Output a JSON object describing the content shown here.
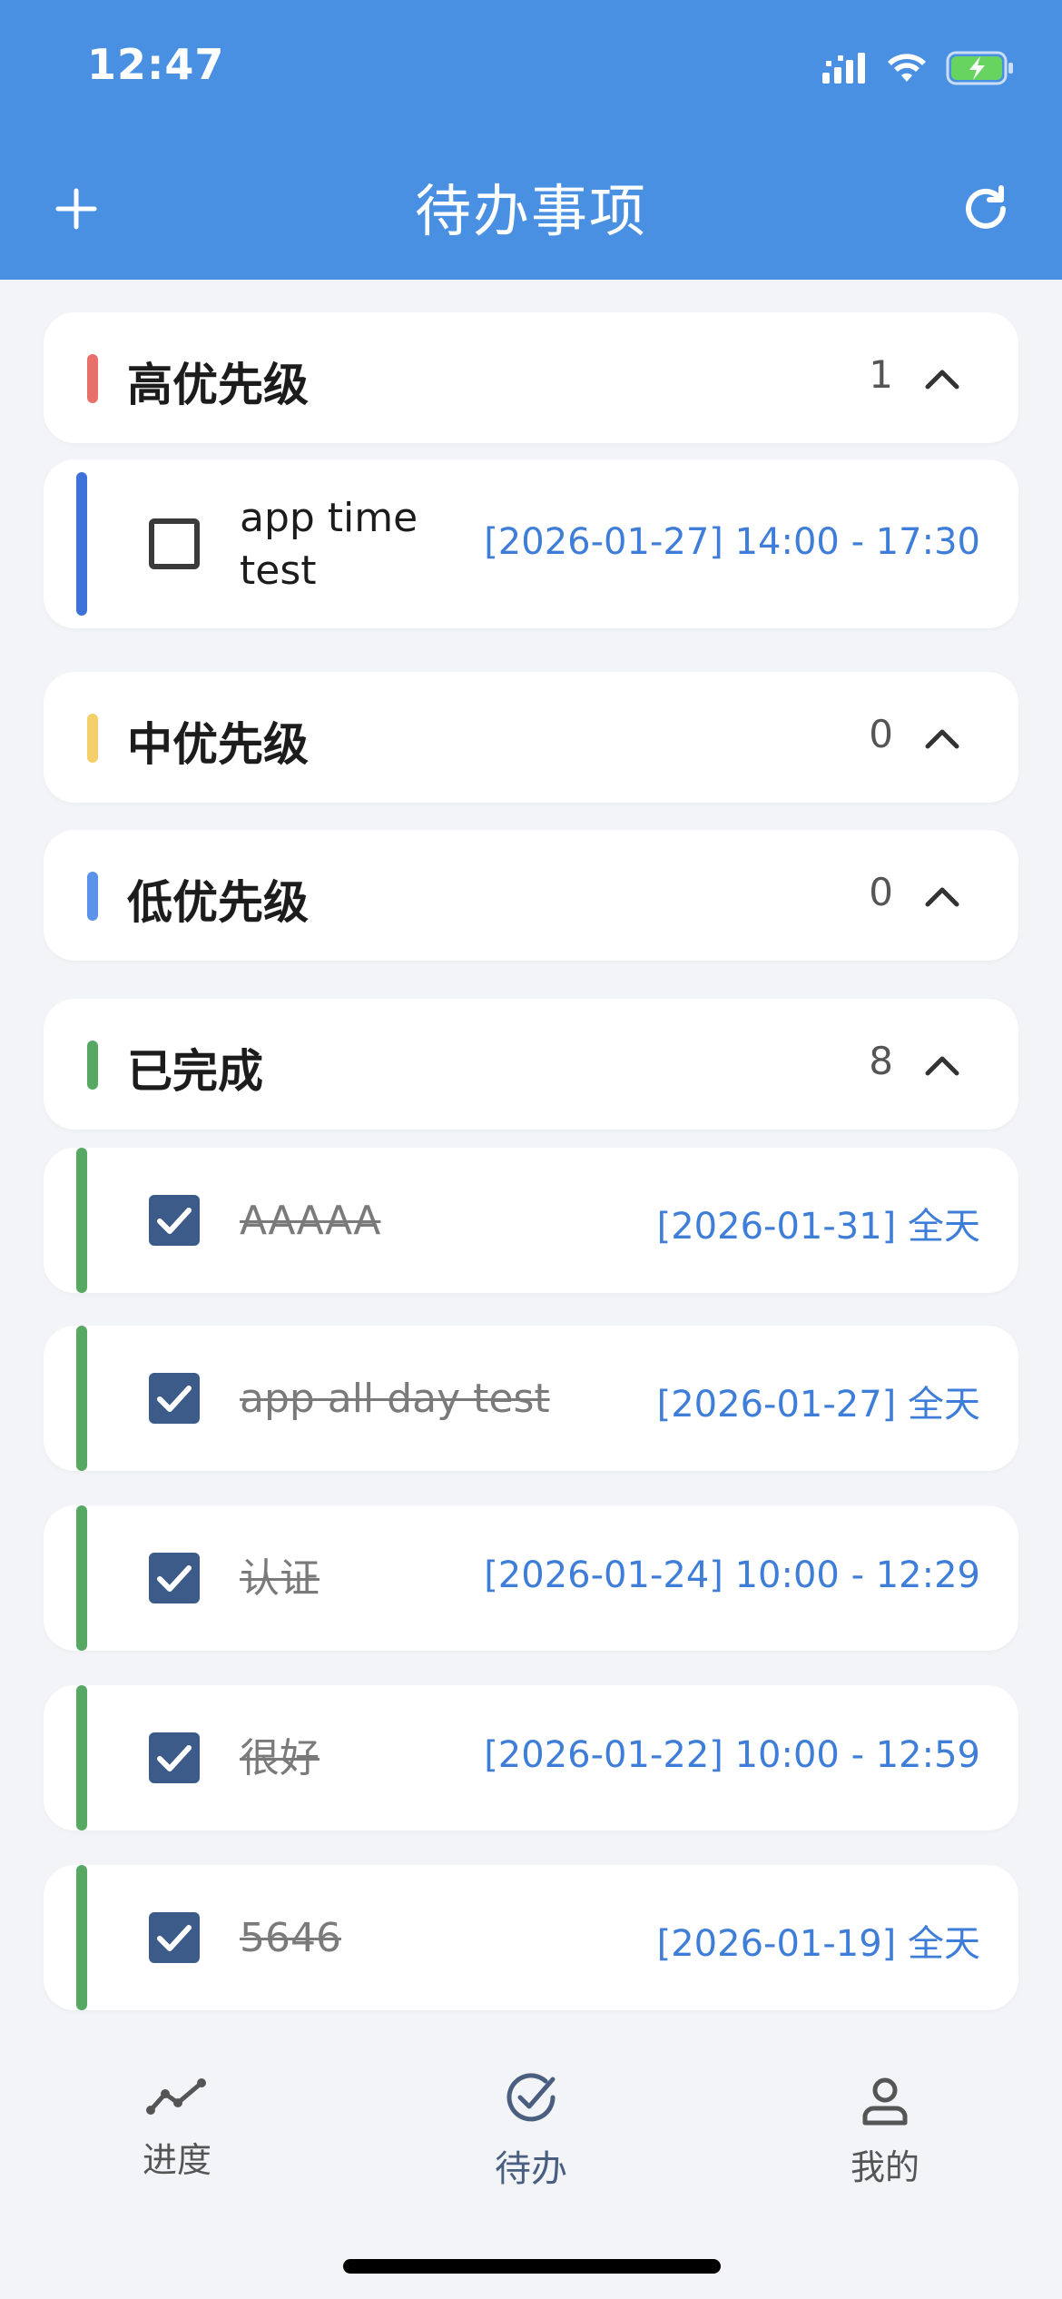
{
  "status_bar": {
    "time": "12:47"
  },
  "header": {
    "title": "待办事项",
    "add_icon": "plus-icon",
    "refresh_icon": "refresh-icon"
  },
  "colors": {
    "header_bg": "#4a90e2",
    "high": "#e8706a",
    "medium": "#f4cf6a",
    "low": "#5b93ea",
    "done": "#56a863",
    "task_bar_high": "#3f72d8",
    "date": "#3f7ed8",
    "checkbox_checked": "#3c5b88"
  },
  "sections": [
    {
      "title": "高优先级",
      "count": "1"
    },
    {
      "title": "中优先级",
      "count": "0"
    },
    {
      "title": "低优先级",
      "count": "0"
    },
    {
      "title": "已完成",
      "count": "8"
    }
  ],
  "high_tasks": [
    {
      "name_line1": "app time",
      "name_line2": "test",
      "date": "[2026-01-27] 14:00 - 17:30",
      "checked": false
    }
  ],
  "done_tasks": [
    {
      "name": "AAAAA",
      "date": "[2026-01-31] 全天",
      "checked": true
    },
    {
      "name": "app all day test",
      "date": "[2026-01-27] 全天",
      "checked": true
    },
    {
      "name": "认证",
      "date": "[2026-01-24] 10:00 - 12:29",
      "checked": true
    },
    {
      "name": "很好",
      "date": "[2026-01-22] 10:00 - 12:59",
      "checked": true
    },
    {
      "name": "5646",
      "date": "[2026-01-19] 全天",
      "checked": true
    }
  ],
  "bottom_nav": [
    {
      "label": "进度",
      "icon": "progress-chart-icon"
    },
    {
      "label": "待办",
      "icon": "check-circle-icon",
      "active": true
    },
    {
      "label": "我的",
      "icon": "profile-icon"
    }
  ]
}
